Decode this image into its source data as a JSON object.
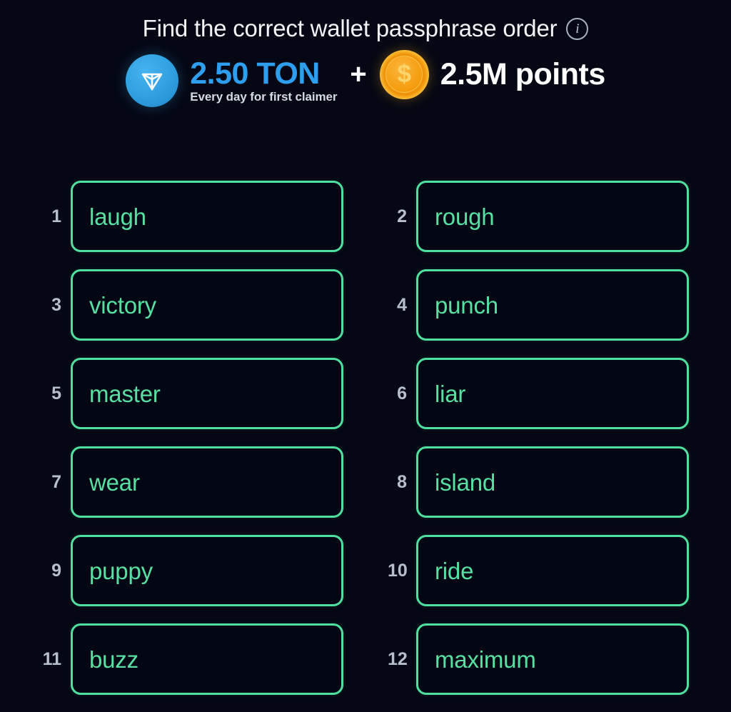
{
  "header": {
    "title": "Find the correct wallet passphrase order",
    "info_icon": "info-circle-icon",
    "info_glyph": "i"
  },
  "reward": {
    "ton_icon": "ton-coin-icon",
    "ton_amount": "2.50 TON",
    "ton_subtitle": "Every day for first claimer",
    "plus": "+",
    "points_icon": "dollar-coin-icon",
    "points_glyph": "$",
    "points_amount": "2.5M points"
  },
  "colors": {
    "background": "#050814",
    "card_border": "#4fe0a0",
    "card_fill": "#030714",
    "word_text": "#57e0a2",
    "index_text": "#b8bfcc",
    "ton_blue": "#2e9ff0",
    "coin_gold": "#f5a116",
    "title_text": "#f2f4f8"
  },
  "words": [
    {
      "index": "1",
      "word": "laugh"
    },
    {
      "index": "2",
      "word": "rough"
    },
    {
      "index": "3",
      "word": "victory"
    },
    {
      "index": "4",
      "word": "punch"
    },
    {
      "index": "5",
      "word": "master"
    },
    {
      "index": "6",
      "word": "liar"
    },
    {
      "index": "7",
      "word": "wear"
    },
    {
      "index": "8",
      "word": "island"
    },
    {
      "index": "9",
      "word": "puppy"
    },
    {
      "index": "10",
      "word": "ride"
    },
    {
      "index": "11",
      "word": "buzz"
    },
    {
      "index": "12",
      "word": "maximum"
    }
  ]
}
